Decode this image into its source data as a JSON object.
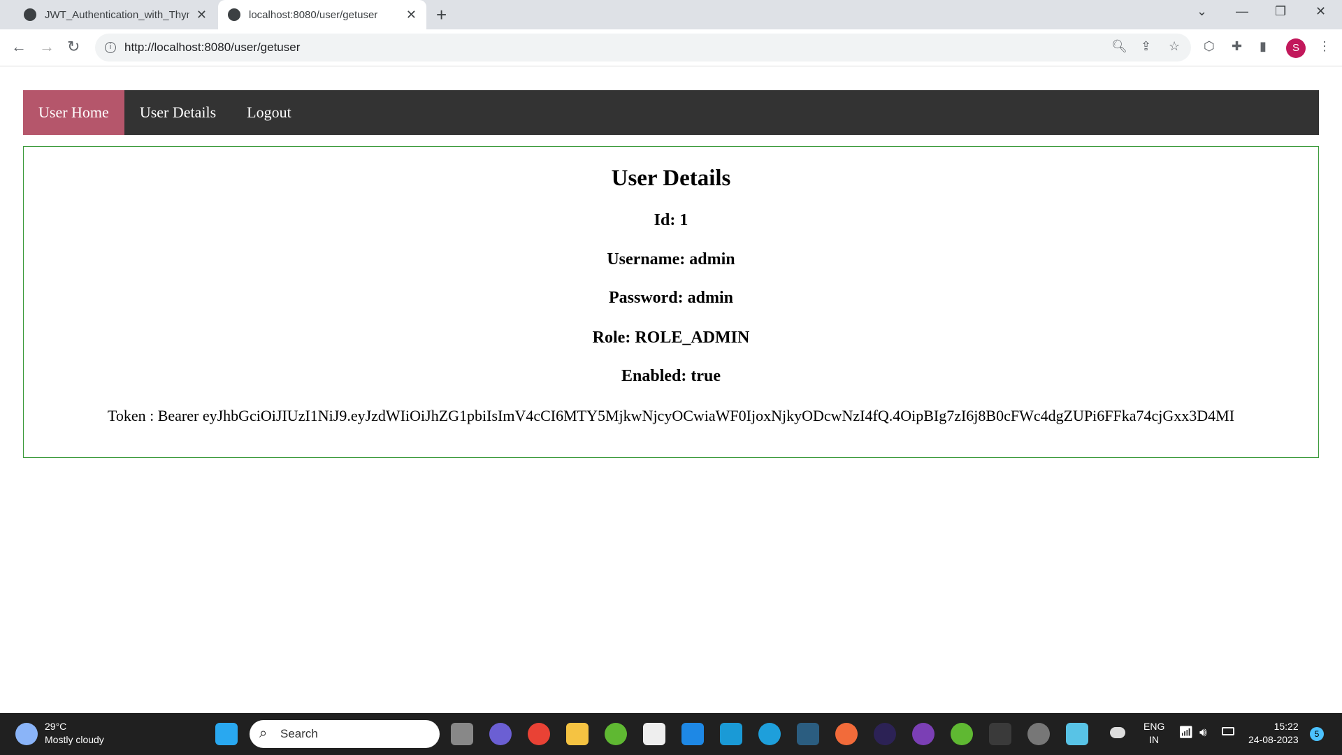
{
  "browser": {
    "tabs": [
      {
        "title": "JWT_Authentication_with_Thymeleaf",
        "icon": "github-icon",
        "active": false
      },
      {
        "title": "localhost:8080/user/getuser",
        "icon": "globe-icon",
        "active": true
      }
    ],
    "url": "http://localhost:8080/user/getuser",
    "profile_initial": "S"
  },
  "nav": {
    "items": [
      {
        "label": "User Home",
        "active": true
      },
      {
        "label": "User Details"
      },
      {
        "label": "Logout"
      }
    ],
    "active_color": "#b5566b"
  },
  "details": {
    "title": "User Details",
    "id": "Id: 1",
    "username": "Username: admin",
    "password": "Password: admin",
    "role": "Role: ROLE_ADMIN",
    "enabled": "Enabled: true",
    "token": "Token : Bearer eyJhbGciOiJIUzI1NiJ9.eyJzdWIiOiJhZG1pbiIsImV4cCI6MTY5MjkwNjcyOCwiaWF0IjoxNjkyODcwNzI4fQ.4OipBIg7zI6j8B0cFWc4dgZUPi6FFka74cjGxx3D4MI"
  },
  "taskbar": {
    "weather_temp": "29°C",
    "weather_desc": "Mostly cloudy",
    "search_placeholder": "Search",
    "lang1": "ENG",
    "lang2": "IN",
    "time": "15:22",
    "date": "24-08-2023",
    "notifications": "5"
  }
}
